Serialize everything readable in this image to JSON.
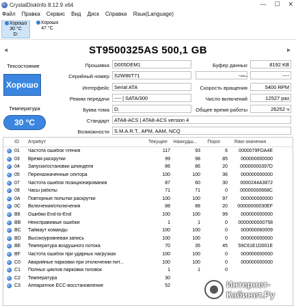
{
  "window": {
    "title": "CrystalDiskInfo 8.12.9 x64",
    "min": "—",
    "max": "☐",
    "close": "✕"
  },
  "menu": [
    "Файл",
    "Правка",
    "Сервис",
    "Вид",
    "Диск",
    "Справка",
    "Язык(Language)"
  ],
  "disk_tabs": [
    {
      "status": "Хорошо",
      "temp": "30 °C",
      "letter": "D:"
    },
    {
      "status": "Хорошо",
      "temp": "47 °C",
      "letter": ""
    }
  ],
  "model": "ST9500325AS 500,1 GB",
  "nav": {
    "prev": "◂",
    "next": "▸"
  },
  "left": {
    "status_label": "Техсостояние",
    "status_value": "Хорошо",
    "temp_label": "Температура",
    "temp_value": "30 °C"
  },
  "fields": {
    "firmware_label": "Прошивка",
    "firmware": "D005DEM1",
    "serial_label": "Серийный номер",
    "serial": "S2W86T71",
    "interface_label": "Интерфейс",
    "interface": "Serial ATA",
    "transfer_label": "Режим передачи",
    "transfer": "---- | SATA/300",
    "volume_label": "Буква тома",
    "volume": "D:",
    "standard_label": "Стандарт",
    "standard": "ATA8-ACS | ATA8-ACS version 4",
    "features_label": "Возможности",
    "features": "S.M.A.R.T., APM, AAM, NCQ",
    "buffer_label": "Буфер данных",
    "buffer": "8192 KB",
    "blank1_label": "----",
    "blank1": "----",
    "blank2_label": "----",
    "blank2": "----",
    "rpm_label": "Скорость вращения",
    "rpm": "5400 RPM",
    "power_count_label": "Число включений",
    "power_count": "12527 раз",
    "power_hours_label": "Общее время работы",
    "power_hours": "26252 ч"
  },
  "smart_headers": {
    "id": "ID",
    "attr": "Атрибут",
    "cur": "Текущее",
    "worst": "Наихудш...",
    "thr": "Порог",
    "raw": "Raw-значения"
  },
  "smart": [
    {
      "id": "01",
      "name": "Частота ошибок чтения",
      "cur": "117",
      "worst": "93",
      "thr": "6",
      "raw": "0000079FDA4E"
    },
    {
      "id": "03",
      "name": "Время раскрутки",
      "cur": "99",
      "worst": "98",
      "thr": "85",
      "raw": "000000000000"
    },
    {
      "id": "04",
      "name": "Запуски/остановки шпинделя",
      "cur": "86",
      "worst": "86",
      "thr": "20",
      "raw": "00000000397D"
    },
    {
      "id": "05",
      "name": "Переназначенные сектора",
      "cur": "100",
      "worst": "100",
      "thr": "36",
      "raw": "000000000000"
    },
    {
      "id": "07",
      "name": "Частота ошибок позиционирования",
      "cur": "87",
      "worst": "60",
      "thr": "30",
      "raw": "0000244A3872"
    },
    {
      "id": "09",
      "name": "Часы работы",
      "cur": "71",
      "worst": "71",
      "thr": "0",
      "raw": "00000000668C"
    },
    {
      "id": "0A",
      "name": "Повторные попытки раскрутки",
      "cur": "100",
      "worst": "100",
      "thr": "97",
      "raw": "000000000000"
    },
    {
      "id": "0C",
      "name": "Включения/отключения",
      "cur": "88",
      "worst": "88",
      "thr": "20",
      "raw": "00000000030EF"
    },
    {
      "id": "B8",
      "name": "Ошибки End-to-End",
      "cur": "100",
      "worst": "100",
      "thr": "99",
      "raw": "000000000000"
    },
    {
      "id": "BB",
      "name": "Неисправимые ошибки",
      "cur": "1",
      "worst": "1",
      "thr": "0",
      "raw": "0000000000758"
    },
    {
      "id": "BC",
      "name": "Таймаут команды",
      "cur": "100",
      "worst": "100",
      "thr": "0",
      "raw": "000000060009"
    },
    {
      "id": "BD",
      "name": "Высокоуровневая запись",
      "cur": "100",
      "worst": "100",
      "thr": "0",
      "raw": "000000000000"
    },
    {
      "id": "BE",
      "name": "Температура воздушного потока",
      "cur": "70",
      "worst": "35",
      "thr": "45",
      "raw": "59C61E1D001E"
    },
    {
      "id": "BF",
      "name": "Частота ошибок при ударных нагрузках",
      "cur": "100",
      "worst": "100",
      "thr": "0",
      "raw": "000000000000"
    },
    {
      "id": "C0",
      "name": "Аварийные парковки при отключении пит...",
      "cur": "100",
      "worst": "100",
      "thr": "0",
      "raw": "000000000000"
    },
    {
      "id": "C1",
      "name": "Полных циклов парковки головок",
      "cur": "1",
      "worst": "1",
      "thr": "0",
      "raw": ""
    },
    {
      "id": "C2",
      "name": "Температура",
      "cur": "30",
      "worst": "",
      "thr": "",
      "raw": ""
    },
    {
      "id": "C3",
      "name": "Аппаратное ECC-восстановление",
      "cur": "52",
      "worst": "",
      "thr": "",
      "raw": ""
    }
  ],
  "watermark": {
    "line1": "Интернет-",
    "line2": "Кабинет.Ру"
  }
}
